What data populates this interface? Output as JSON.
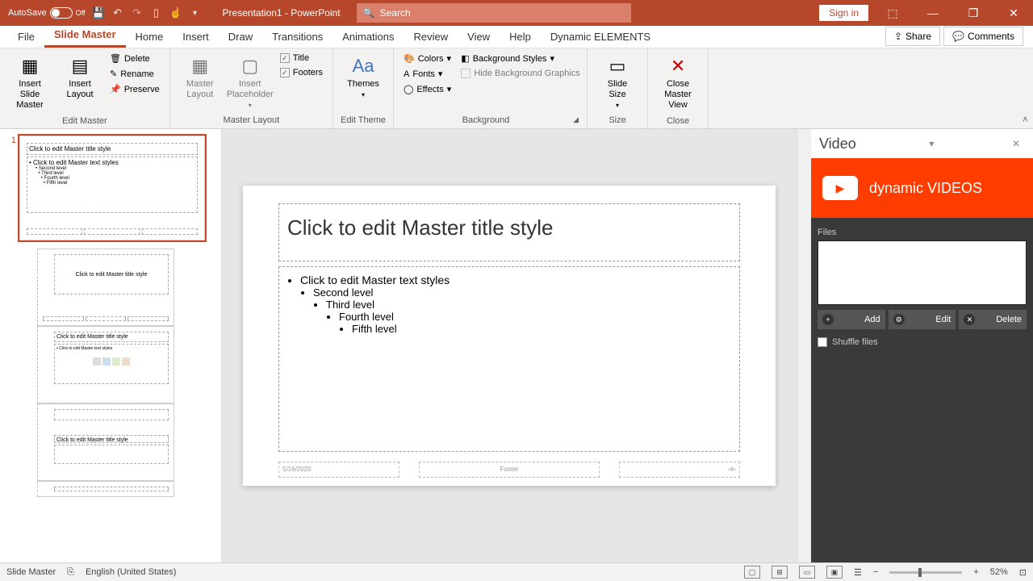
{
  "titlebar": {
    "autosave_label": "AutoSave",
    "autosave_state": "Off",
    "doc_title": "Presentation1 - PowerPoint",
    "search_placeholder": "Search",
    "signin": "Sign in"
  },
  "tabs": [
    "File",
    "Slide Master",
    "Home",
    "Insert",
    "Draw",
    "Transitions",
    "Animations",
    "Review",
    "View",
    "Help",
    "Dynamic ELEMENTS"
  ],
  "active_tab": "Slide Master",
  "share": "Share",
  "comments": "Comments",
  "ribbon": {
    "edit_master": {
      "insert_slide_master": "Insert Slide\nMaster",
      "insert_layout": "Insert\nLayout",
      "delete": "Delete",
      "rename": "Rename",
      "preserve": "Preserve",
      "label": "Edit Master"
    },
    "master_layout": {
      "master_layout": "Master\nLayout",
      "insert_placeholder": "Insert\nPlaceholder",
      "title_chk": "Title",
      "footers_chk": "Footers",
      "label": "Master Layout"
    },
    "edit_theme": {
      "themes": "Themes",
      "label": "Edit Theme"
    },
    "background": {
      "colors": "Colors",
      "fonts": "Fonts",
      "effects": "Effects",
      "bg_styles": "Background Styles",
      "hide_bg": "Hide Background Graphics",
      "label": "Background"
    },
    "size": {
      "slide_size": "Slide\nSize",
      "label": "Size"
    },
    "close": {
      "close_master": "Close\nMaster View",
      "label": "Close"
    }
  },
  "slide": {
    "title": "Click to edit Master title style",
    "body_l1": "Click to edit Master text styles",
    "body_l2": "Second level",
    "body_l3": "Third level",
    "body_l4": "Fourth level",
    "body_l5": "Fifth level",
    "date": "5/16/2020",
    "footer": "Footer",
    "num": "‹#›"
  },
  "thumbs": {
    "num1": "1",
    "master_title": "Click to edit Master title style",
    "master_sub": "• Click to edit Master text styles",
    "layout_title": "Click to edit Master title style"
  },
  "pane": {
    "title": "Video",
    "banner": "dynamic VIDEOS",
    "files_label": "Files",
    "add": "Add",
    "edit": "Edit",
    "delete": "Delete",
    "shuffle": "Shuffle files"
  },
  "status": {
    "mode": "Slide Master",
    "lang": "English (United States)",
    "zoom": "52%"
  }
}
